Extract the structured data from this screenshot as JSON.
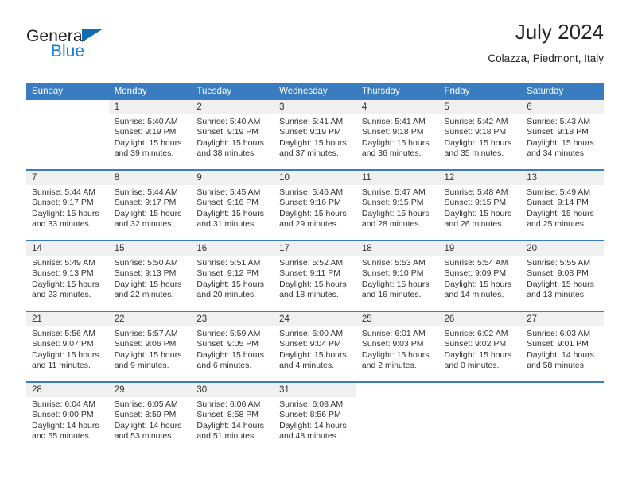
{
  "logo": {
    "word_one": "General",
    "word_two": "Blue",
    "triangle_icon": "triangle-icon",
    "accent_dark": "#231f20",
    "accent_blue": "#1a7fd4"
  },
  "header": {
    "title": "July 2024",
    "subtitle": "Colazza, Piedmont, Italy"
  },
  "theme": {
    "header_bg": "#3a7cc0",
    "daynum_bg": "#f0f0f0",
    "text": "#333333"
  },
  "calendar": {
    "weekday_headers": [
      "Sunday",
      "Monday",
      "Tuesday",
      "Wednesday",
      "Thursday",
      "Friday",
      "Saturday"
    ],
    "weeks": [
      [
        {
          "day": "",
          "sunrise": "",
          "sunset": "",
          "daylight_1": "",
          "daylight_2": ""
        },
        {
          "day": "1",
          "sunrise": "Sunrise: 5:40 AM",
          "sunset": "Sunset: 9:19 PM",
          "daylight_1": "Daylight: 15 hours",
          "daylight_2": "and 39 minutes."
        },
        {
          "day": "2",
          "sunrise": "Sunrise: 5:40 AM",
          "sunset": "Sunset: 9:19 PM",
          "daylight_1": "Daylight: 15 hours",
          "daylight_2": "and 38 minutes."
        },
        {
          "day": "3",
          "sunrise": "Sunrise: 5:41 AM",
          "sunset": "Sunset: 9:19 PM",
          "daylight_1": "Daylight: 15 hours",
          "daylight_2": "and 37 minutes."
        },
        {
          "day": "4",
          "sunrise": "Sunrise: 5:41 AM",
          "sunset": "Sunset: 9:18 PM",
          "daylight_1": "Daylight: 15 hours",
          "daylight_2": "and 36 minutes."
        },
        {
          "day": "5",
          "sunrise": "Sunrise: 5:42 AM",
          "sunset": "Sunset: 9:18 PM",
          "daylight_1": "Daylight: 15 hours",
          "daylight_2": "and 35 minutes."
        },
        {
          "day": "6",
          "sunrise": "Sunrise: 5:43 AM",
          "sunset": "Sunset: 9:18 PM",
          "daylight_1": "Daylight: 15 hours",
          "daylight_2": "and 34 minutes."
        }
      ],
      [
        {
          "day": "7",
          "sunrise": "Sunrise: 5:44 AM",
          "sunset": "Sunset: 9:17 PM",
          "daylight_1": "Daylight: 15 hours",
          "daylight_2": "and 33 minutes."
        },
        {
          "day": "8",
          "sunrise": "Sunrise: 5:44 AM",
          "sunset": "Sunset: 9:17 PM",
          "daylight_1": "Daylight: 15 hours",
          "daylight_2": "and 32 minutes."
        },
        {
          "day": "9",
          "sunrise": "Sunrise: 5:45 AM",
          "sunset": "Sunset: 9:16 PM",
          "daylight_1": "Daylight: 15 hours",
          "daylight_2": "and 31 minutes."
        },
        {
          "day": "10",
          "sunrise": "Sunrise: 5:46 AM",
          "sunset": "Sunset: 9:16 PM",
          "daylight_1": "Daylight: 15 hours",
          "daylight_2": "and 29 minutes."
        },
        {
          "day": "11",
          "sunrise": "Sunrise: 5:47 AM",
          "sunset": "Sunset: 9:15 PM",
          "daylight_1": "Daylight: 15 hours",
          "daylight_2": "and 28 minutes."
        },
        {
          "day": "12",
          "sunrise": "Sunrise: 5:48 AM",
          "sunset": "Sunset: 9:15 PM",
          "daylight_1": "Daylight: 15 hours",
          "daylight_2": "and 26 minutes."
        },
        {
          "day": "13",
          "sunrise": "Sunrise: 5:49 AM",
          "sunset": "Sunset: 9:14 PM",
          "daylight_1": "Daylight: 15 hours",
          "daylight_2": "and 25 minutes."
        }
      ],
      [
        {
          "day": "14",
          "sunrise": "Sunrise: 5:49 AM",
          "sunset": "Sunset: 9:13 PM",
          "daylight_1": "Daylight: 15 hours",
          "daylight_2": "and 23 minutes."
        },
        {
          "day": "15",
          "sunrise": "Sunrise: 5:50 AM",
          "sunset": "Sunset: 9:13 PM",
          "daylight_1": "Daylight: 15 hours",
          "daylight_2": "and 22 minutes."
        },
        {
          "day": "16",
          "sunrise": "Sunrise: 5:51 AM",
          "sunset": "Sunset: 9:12 PM",
          "daylight_1": "Daylight: 15 hours",
          "daylight_2": "and 20 minutes."
        },
        {
          "day": "17",
          "sunrise": "Sunrise: 5:52 AM",
          "sunset": "Sunset: 9:11 PM",
          "daylight_1": "Daylight: 15 hours",
          "daylight_2": "and 18 minutes."
        },
        {
          "day": "18",
          "sunrise": "Sunrise: 5:53 AM",
          "sunset": "Sunset: 9:10 PM",
          "daylight_1": "Daylight: 15 hours",
          "daylight_2": "and 16 minutes."
        },
        {
          "day": "19",
          "sunrise": "Sunrise: 5:54 AM",
          "sunset": "Sunset: 9:09 PM",
          "daylight_1": "Daylight: 15 hours",
          "daylight_2": "and 14 minutes."
        },
        {
          "day": "20",
          "sunrise": "Sunrise: 5:55 AM",
          "sunset": "Sunset: 9:08 PM",
          "daylight_1": "Daylight: 15 hours",
          "daylight_2": "and 13 minutes."
        }
      ],
      [
        {
          "day": "21",
          "sunrise": "Sunrise: 5:56 AM",
          "sunset": "Sunset: 9:07 PM",
          "daylight_1": "Daylight: 15 hours",
          "daylight_2": "and 11 minutes."
        },
        {
          "day": "22",
          "sunrise": "Sunrise: 5:57 AM",
          "sunset": "Sunset: 9:06 PM",
          "daylight_1": "Daylight: 15 hours",
          "daylight_2": "and 9 minutes."
        },
        {
          "day": "23",
          "sunrise": "Sunrise: 5:59 AM",
          "sunset": "Sunset: 9:05 PM",
          "daylight_1": "Daylight: 15 hours",
          "daylight_2": "and 6 minutes."
        },
        {
          "day": "24",
          "sunrise": "Sunrise: 6:00 AM",
          "sunset": "Sunset: 9:04 PM",
          "daylight_1": "Daylight: 15 hours",
          "daylight_2": "and 4 minutes."
        },
        {
          "day": "25",
          "sunrise": "Sunrise: 6:01 AM",
          "sunset": "Sunset: 9:03 PM",
          "daylight_1": "Daylight: 15 hours",
          "daylight_2": "and 2 minutes."
        },
        {
          "day": "26",
          "sunrise": "Sunrise: 6:02 AM",
          "sunset": "Sunset: 9:02 PM",
          "daylight_1": "Daylight: 15 hours",
          "daylight_2": "and 0 minutes."
        },
        {
          "day": "27",
          "sunrise": "Sunrise: 6:03 AM",
          "sunset": "Sunset: 9:01 PM",
          "daylight_1": "Daylight: 14 hours",
          "daylight_2": "and 58 minutes."
        }
      ],
      [
        {
          "day": "28",
          "sunrise": "Sunrise: 6:04 AM",
          "sunset": "Sunset: 9:00 PM",
          "daylight_1": "Daylight: 14 hours",
          "daylight_2": "and 55 minutes."
        },
        {
          "day": "29",
          "sunrise": "Sunrise: 6:05 AM",
          "sunset": "Sunset: 8:59 PM",
          "daylight_1": "Daylight: 14 hours",
          "daylight_2": "and 53 minutes."
        },
        {
          "day": "30",
          "sunrise": "Sunrise: 6:06 AM",
          "sunset": "Sunset: 8:58 PM",
          "daylight_1": "Daylight: 14 hours",
          "daylight_2": "and 51 minutes."
        },
        {
          "day": "31",
          "sunrise": "Sunrise: 6:08 AM",
          "sunset": "Sunset: 8:56 PM",
          "daylight_1": "Daylight: 14 hours",
          "daylight_2": "and 48 minutes."
        },
        {
          "day": "",
          "sunrise": "",
          "sunset": "",
          "daylight_1": "",
          "daylight_2": ""
        },
        {
          "day": "",
          "sunrise": "",
          "sunset": "",
          "daylight_1": "",
          "daylight_2": ""
        },
        {
          "day": "",
          "sunrise": "",
          "sunset": "",
          "daylight_1": "",
          "daylight_2": ""
        }
      ]
    ]
  }
}
